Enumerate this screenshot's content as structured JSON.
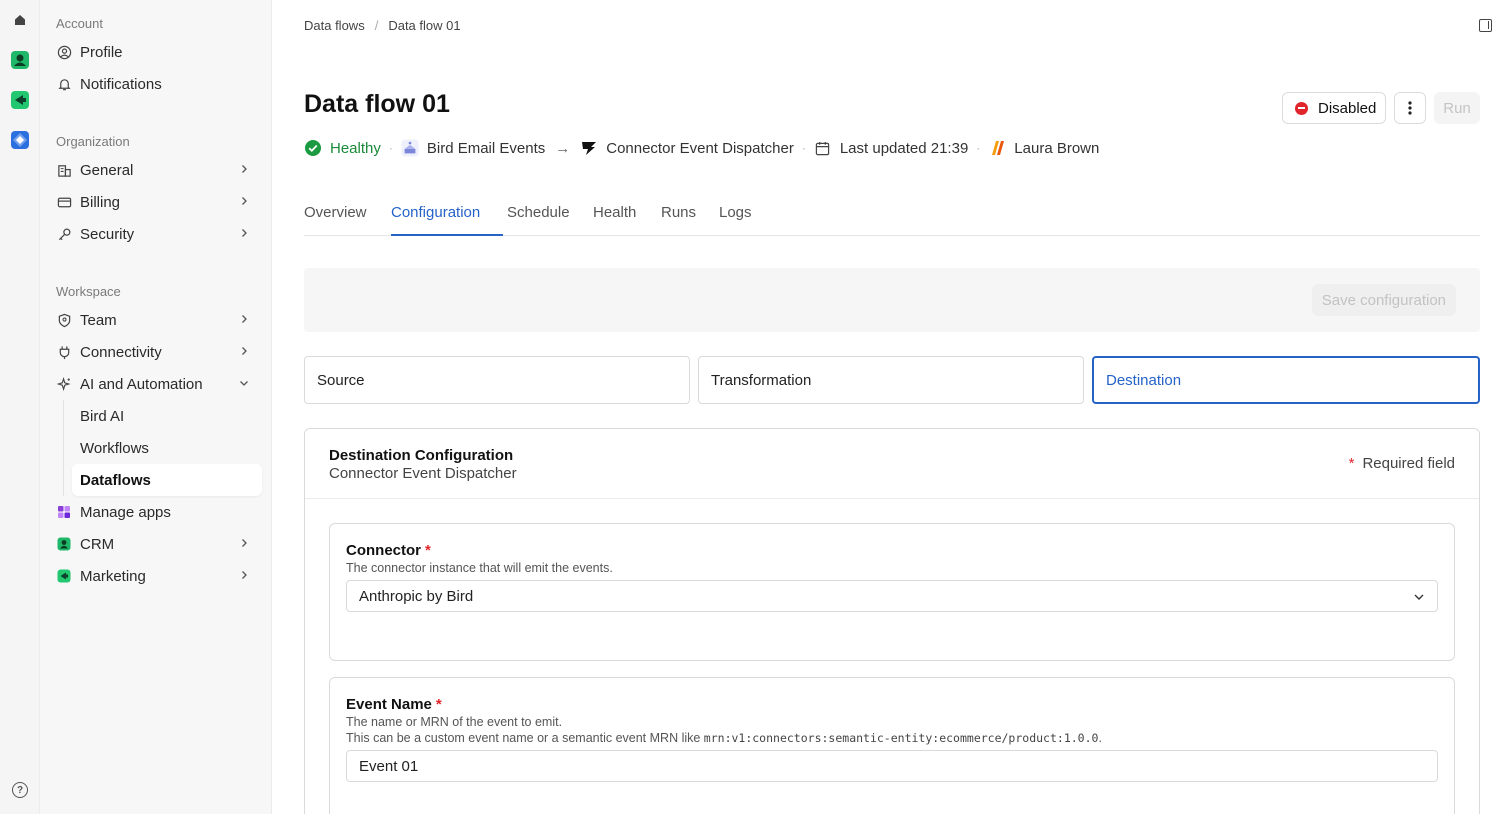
{
  "breadcrumb": {
    "root": "Data flows",
    "separator": "/",
    "current": "Data flow 01"
  },
  "page": {
    "title": "Data flow 01"
  },
  "header_actions": {
    "status_label": "Disabled",
    "run_label": "Run"
  },
  "meta": {
    "health": "Healthy",
    "source": "Bird Email Events",
    "destination": "Connector Event Dispatcher",
    "updated": "Last updated 21:39",
    "owner": "Laura Brown"
  },
  "tabs": [
    "Overview",
    "Configuration",
    "Schedule",
    "Health",
    "Runs",
    "Logs"
  ],
  "save_label": "Save configuration",
  "steps": [
    "Source",
    "Transformation",
    "Destination"
  ],
  "card": {
    "title": "Destination Configuration",
    "subtitle": "Connector Event Dispatcher",
    "required_star": "*",
    "required_label": "Required field"
  },
  "fields": {
    "connector": {
      "label": "Connector",
      "star": "*",
      "help": "The connector instance that will emit the events.",
      "value": "Anthropic by Bird"
    },
    "event_name": {
      "label": "Event Name",
      "star": "*",
      "help1": "The name or MRN of the event to emit.",
      "help2_prefix": "This can be a custom event name or a semantic event MRN like ",
      "help2_code": "mrn:v1:connectors:semantic-entity:ecommerce/product:1.0.0",
      "help2_suffix": ".",
      "value": "Event 01"
    }
  },
  "sidebar": {
    "account_label": "Account",
    "account": [
      "Profile",
      "Notifications"
    ],
    "organization_label": "Organization",
    "organization": [
      "General",
      "Billing",
      "Security"
    ],
    "workspace_label": "Workspace",
    "workspace": [
      "Team",
      "Connectivity",
      "AI and Automation"
    ],
    "ai_sub": [
      "Bird AI",
      "Workflows",
      "Dataflows"
    ],
    "apps": [
      "Manage apps",
      "CRM",
      "Marketing"
    ]
  },
  "colors": {
    "accent": "#2563c9",
    "healthy": "#1b8a3a",
    "danger": "#e0262b"
  }
}
